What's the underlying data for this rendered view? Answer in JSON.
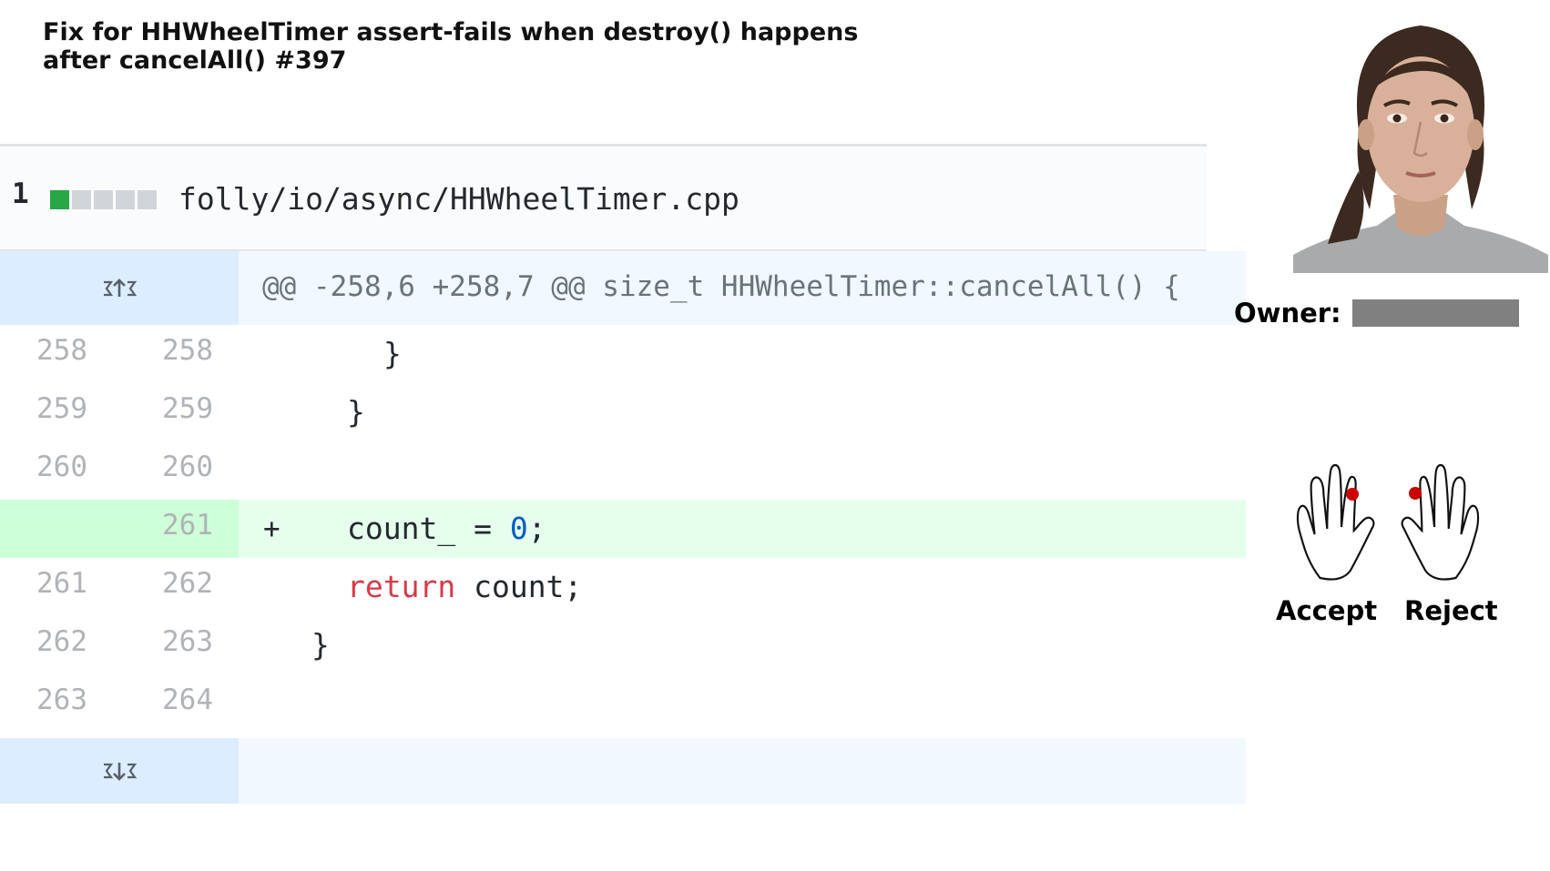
{
  "pr_title_line1": "Fix for HHWheelTimer assert-fails when destroy() happens",
  "pr_title_line2": "after cancelAll() #397",
  "file": {
    "change_count": "1",
    "path": "folly/io/async/HHWheelTimer.cpp",
    "diffstat": [
      "add",
      "neutral",
      "neutral",
      "neutral",
      "neutral"
    ]
  },
  "hunk_header": "@@ -258,6 +258,7 @@ size_t HHWheelTimer::cancelAll() {",
  "lines": [
    {
      "old": "258",
      "new": "258",
      "marker": "",
      "code": "}",
      "indent": 7
    },
    {
      "old": "259",
      "new": "259",
      "marker": "",
      "code": "}",
      "indent": 6
    },
    {
      "old": "260",
      "new": "260",
      "marker": "",
      "code": "",
      "indent": 0
    },
    {
      "old": "",
      "new": "261",
      "marker": "+",
      "code": "count_ = 0;",
      "indent": 6,
      "type": "added"
    },
    {
      "old": "261",
      "new": "262",
      "marker": "",
      "code": "return count;",
      "indent": 6
    },
    {
      "old": "262",
      "new": "263",
      "marker": "",
      "code": "}",
      "indent": 5
    },
    {
      "old": "263",
      "new": "264",
      "marker": "",
      "code": "",
      "indent": 0
    }
  ],
  "owner": {
    "label": "Owner:",
    "value_redacted": true
  },
  "actions": {
    "accept_label": "Accept",
    "reject_label": "Reject"
  },
  "colors": {
    "added_row": "#e6ffed",
    "added_gutter": "#cdffd8",
    "hunk_bg": "#f1f8ff",
    "hunk_gutter": "#dbedff",
    "keyword": "#d73a49",
    "number": "#005cc5",
    "finger_marker": "#cc0000"
  }
}
